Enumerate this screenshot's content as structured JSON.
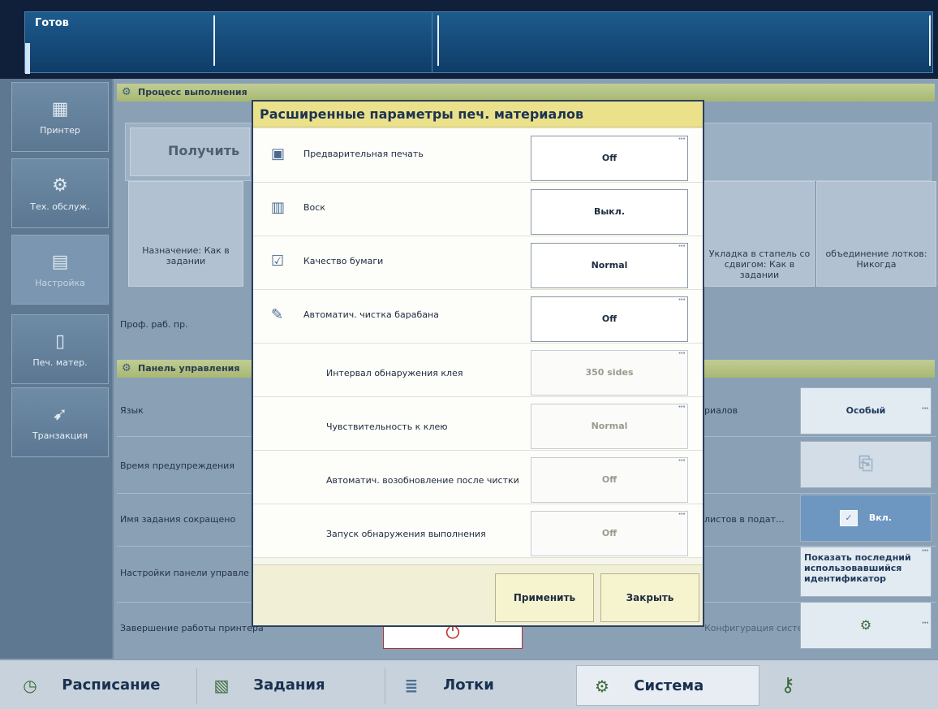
{
  "status": {
    "label": "Готов"
  },
  "nav": [
    {
      "label": "Принтер",
      "icon": "printer-icon"
    },
    {
      "label": "Тех. обслуж.",
      "icon": "maintenance-icon"
    },
    {
      "label": "Настройка",
      "icon": "settings-icon"
    },
    {
      "label": "Печ. матер.",
      "icon": "media-icon"
    },
    {
      "label": "Транзакция",
      "icon": "transaction-icon"
    }
  ],
  "workflow": {
    "header": "Процесс выполнения",
    "receive_label": "Получить",
    "tile_assign": "Назначение: Как в задании",
    "tile_stack": "Укладка в стапель со сдвигом: Как в задании",
    "tile_tray": "объединение лотков: Никогда",
    "prof_label": "Проф. раб. пр."
  },
  "control_panel": {
    "header": "Панель управления",
    "rows": [
      "Язык",
      "Время предупреждения",
      "Имя задания сокращено",
      "Настройки панели управле",
      "Завершение работы принтера"
    ],
    "right_labels": {
      "media": "риалов",
      "sheets": "листов в подат...",
      "config": "Конфигурация системы"
    },
    "btn_special": "Особый",
    "btn_on": "Вкл.",
    "btn_last_id": "Показать последний использовавшийся идентификатор"
  },
  "dialog": {
    "title": "Расширенные параметры печ. материалов",
    "rows": [
      {
        "label": "Предварительная печать",
        "value": "Off"
      },
      {
        "label": "Воск",
        "value": "Выкл."
      },
      {
        "label": "Качество бумаги",
        "value": "Normal"
      },
      {
        "label": "Автоматич. чистка барабана",
        "value": "Off"
      },
      {
        "label": "Интервал обнаружения клея",
        "value": "350 sides"
      },
      {
        "label": "Чувствительность к клею",
        "value": "Normal"
      },
      {
        "label": "Автоматич. возобновление после чистки",
        "value": "Off"
      },
      {
        "label": "Запуск обнаружения выполнения",
        "value": "Off"
      }
    ],
    "apply": "Применить",
    "close": "Закрыть"
  },
  "bottom_tabs": [
    {
      "label": "Расписание",
      "icon": "clock-icon"
    },
    {
      "label": "Задания",
      "icon": "document-icon"
    },
    {
      "label": "Лотки",
      "icon": "tray-icon"
    },
    {
      "label": "Система",
      "icon": "gears-icon"
    }
  ]
}
